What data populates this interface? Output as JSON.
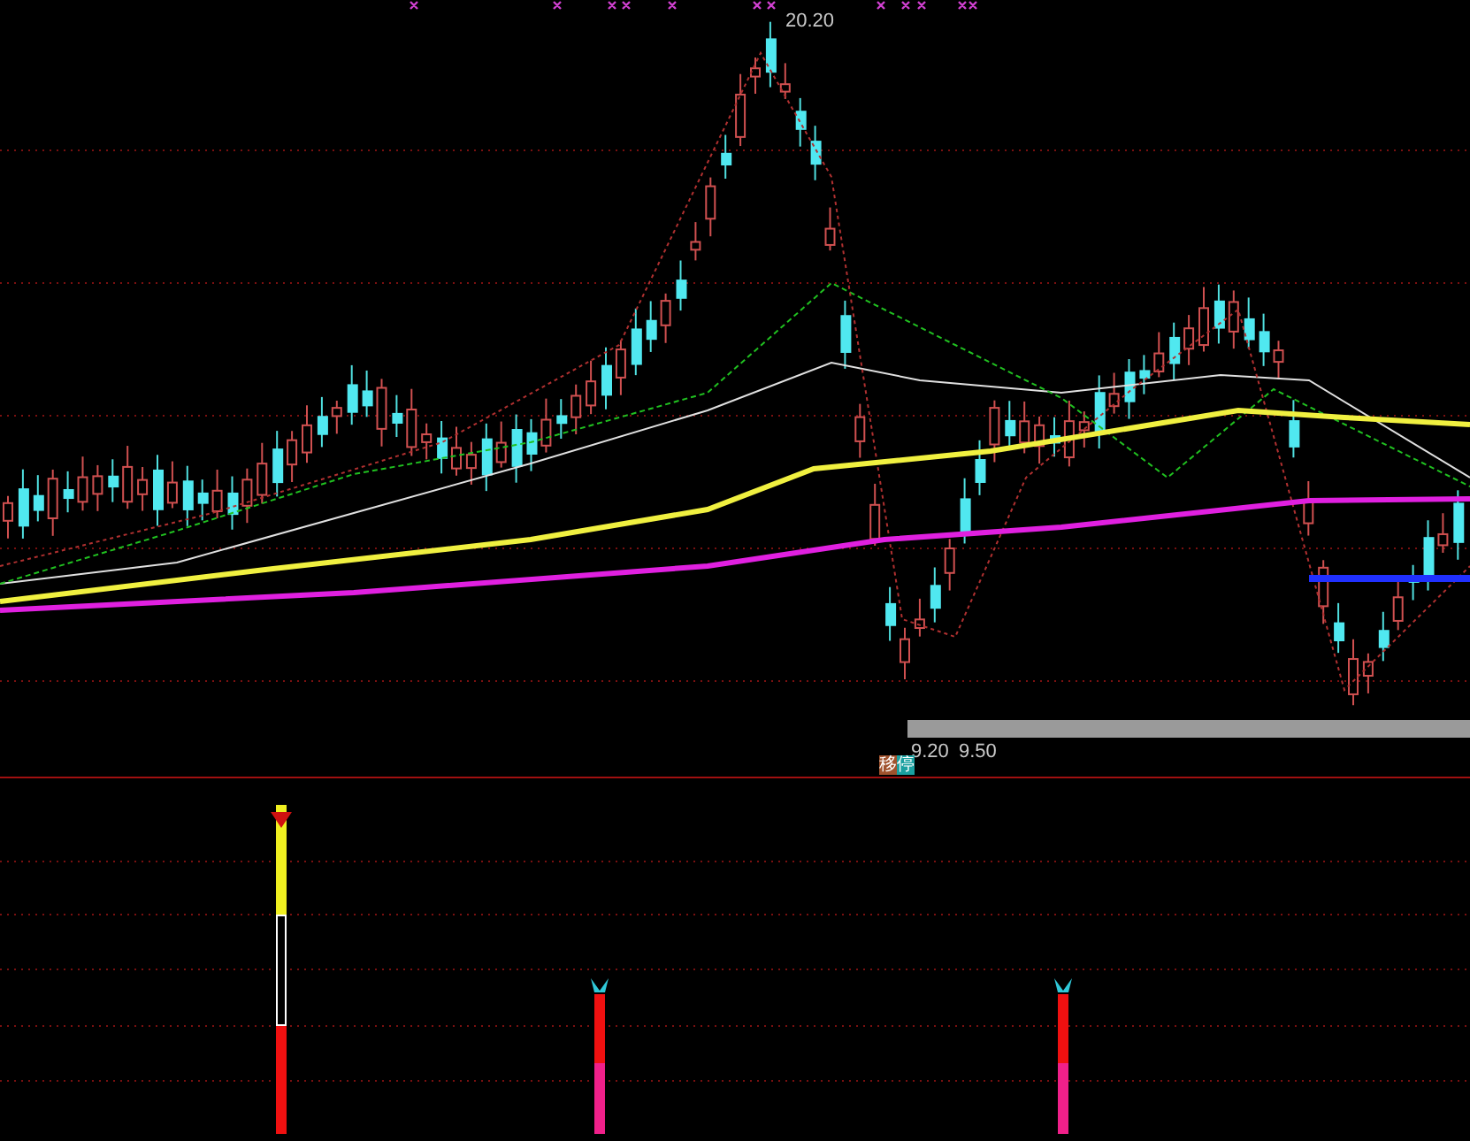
{
  "price_panel": {
    "high_label": "20.20",
    "low_labels": [
      "9.20",
      "9.50"
    ],
    "badge": "移停"
  }
}
